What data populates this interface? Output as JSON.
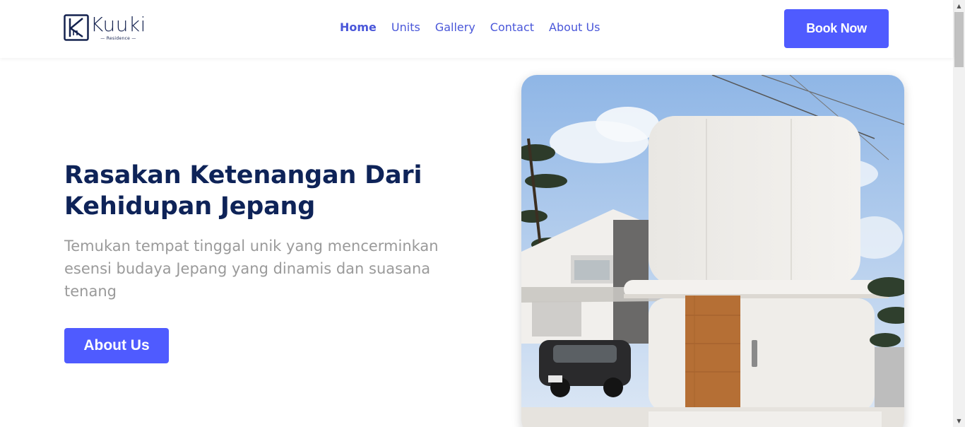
{
  "brand": {
    "name": "Kuuki",
    "tagline": "Residence"
  },
  "nav": {
    "items": [
      {
        "label": "Home",
        "active": true
      },
      {
        "label": "Units",
        "active": false
      },
      {
        "label": "Gallery",
        "active": false
      },
      {
        "label": "Contact",
        "active": false
      },
      {
        "label": "About Us",
        "active": false
      }
    ]
  },
  "header": {
    "cta_label": "Book Now"
  },
  "hero": {
    "title": "Rasakan Ketenangan Dari Kehidupan Jepang",
    "description": "Temukan tempat tinggal unik yang mencerminkan esensi budaya Jepang yang dinamis dan suasana tenang",
    "button_label": "About Us",
    "image_icon": "modern-japanese-house-photo"
  },
  "colors": {
    "accent": "#4f5bff",
    "title": "#0e2358",
    "nav": "#4a57d9",
    "muted": "#9a9a9a"
  }
}
